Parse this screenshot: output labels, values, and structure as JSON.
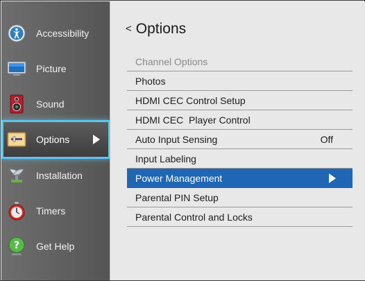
{
  "sidebar": {
    "items": [
      {
        "label": "Accessibility",
        "icon": "accessibility-icon"
      },
      {
        "label": "Picture",
        "icon": "picture-icon"
      },
      {
        "label": "Sound",
        "icon": "speaker-icon"
      },
      {
        "label": "Options",
        "icon": "options-icon",
        "selected": true
      },
      {
        "label": "Installation",
        "icon": "satellite-dish-icon"
      },
      {
        "label": "Timers",
        "icon": "stopwatch-icon"
      },
      {
        "label": "Get Help",
        "icon": "help-icon"
      }
    ]
  },
  "main": {
    "back_glyph": "<",
    "title": "Options",
    "items": [
      {
        "label": "Channel Options",
        "disabled": true
      },
      {
        "label": "Photos"
      },
      {
        "label": "HDMI CEC Control Setup"
      },
      {
        "label": "HDMI CEC  Player Control"
      },
      {
        "label": "Auto Input Sensing",
        "value": "Off"
      },
      {
        "label": "Input Labeling"
      },
      {
        "label": "Power Management",
        "highlighted": true
      },
      {
        "label": "Parental PIN Setup"
      },
      {
        "label": "Parental Control and Locks"
      }
    ]
  },
  "colors": {
    "highlight": "#1f66b4",
    "selection_glow": "#59c6ea",
    "sidebar_bg": "#5f5f5f",
    "panel_bg": "#e8e8e8"
  }
}
